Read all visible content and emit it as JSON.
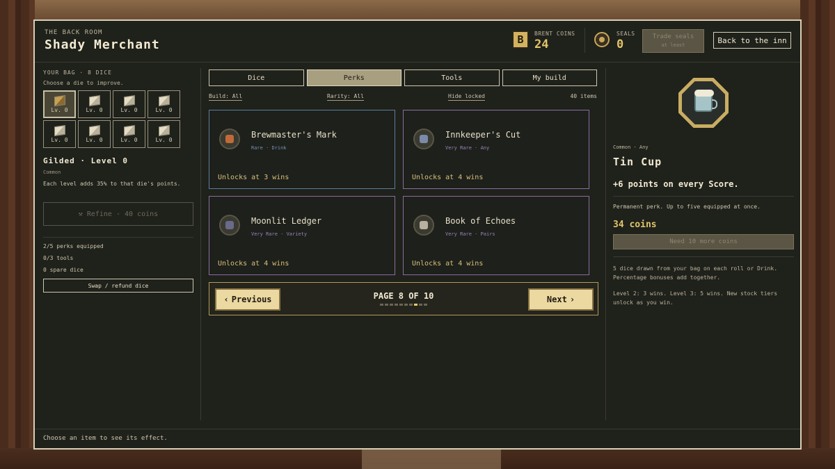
{
  "header": {
    "kicker": "THE BACK ROOM",
    "title": "Shady Merchant",
    "coins_label": "BRENT COINS",
    "coins_icon": "B",
    "coins_value": "24",
    "seals_label": "SEALS",
    "seals_value": "0",
    "trade_label_1": "Trade seals",
    "trade_label_2": "at least",
    "back_label": "Back to the inn"
  },
  "bag": {
    "title": "YOUR BAG · 8 DICE",
    "hint": "Choose a die to improve.",
    "dice": [
      {
        "level": "Lv. 0"
      },
      {
        "level": "Lv. 0"
      },
      {
        "level": "Lv. 0"
      },
      {
        "level": "Lv. 0"
      },
      {
        "level": "Lv. 0"
      },
      {
        "level": "Lv. 0"
      },
      {
        "level": "Lv. 0"
      },
      {
        "level": "Lv. 0"
      }
    ],
    "selected_name": "Gilded · Level 0",
    "selected_rarity": "Common",
    "selected_desc": "Each level adds 35% to that die's points.",
    "refine_label": "Refine · 40 coins",
    "perks_equipped": "2/5 perks equipped",
    "tools": "0/3 tools",
    "spare": "0 spare dice",
    "swap_label": "Swap / refund dice"
  },
  "tabs": [
    "Dice",
    "Perks",
    "Tools",
    "My build"
  ],
  "active_tab": "Perks",
  "filters": {
    "build": "Build: All",
    "rarity": "Rarity: All",
    "hide": "Hide locked",
    "count": "40 items"
  },
  "cards": [
    {
      "name": "Brewmaster's Mark",
      "rarity": "Rare · Drink",
      "unlock": "Unlocks at 3 wins",
      "icon": "badge-icon",
      "color": "#c06a3a"
    },
    {
      "name": "Innkeeper's Cut",
      "rarity": "Very Rare · Any",
      "unlock": "Unlocks at 4 wins",
      "icon": "coin-purse-icon",
      "color": "#7a8aa8"
    },
    {
      "name": "Moonlit Ledger",
      "rarity": "Very Rare · Variety",
      "unlock": "Unlocks at 4 wins",
      "icon": "ledger-icon",
      "color": "#6a6a8a"
    },
    {
      "name": "Book of Echoes",
      "rarity": "Very Rare · Pairs",
      "unlock": "Unlocks at 4 wins",
      "icon": "book-icon",
      "color": "#b8b0a0"
    }
  ],
  "pager": {
    "prev_label": "Previous",
    "next_label": "Next",
    "page_label": "PAGE 8 OF 10",
    "current": 8,
    "total": 10
  },
  "detail": {
    "rarity": "Common · Any",
    "name": "Tin Cup",
    "effect": "+6 points on every Score.",
    "perm": "Permanent perk. Up to five equipped at once.",
    "price": "34 coins",
    "need": "Need 10 more coins",
    "note1": "5 dice drawn from your bag on each roll or Drink. Percentage bonuses add together.",
    "note2": "Level 2: 3 wins. Level 3: 5 wins. New stock tiers unlock as you win."
  },
  "footer": "Choose an item to see its effect.",
  "colors": {
    "accent": "#e2c46a",
    "rare_border": "#5b7f9c",
    "very_rare_border": "#8a6ea0"
  }
}
